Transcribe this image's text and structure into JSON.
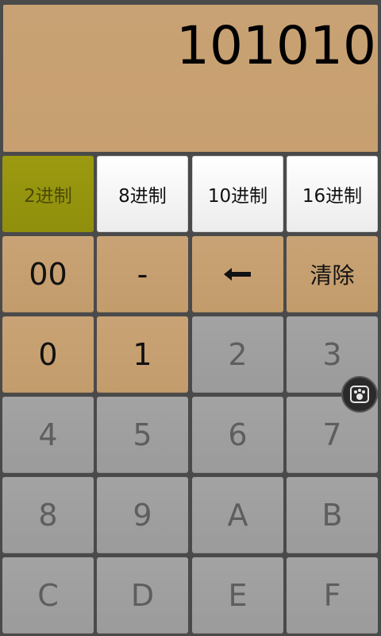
{
  "display": {
    "value": "101010"
  },
  "modes": [
    {
      "label": "2进制",
      "selected": true
    },
    {
      "label": "8进制",
      "selected": false
    },
    {
      "label": "10进制",
      "selected": false
    },
    {
      "label": "16进制",
      "selected": false
    }
  ],
  "controls": {
    "double_zero": "00",
    "minus": "-",
    "backspace": "←",
    "clear": "清除"
  },
  "digits": [
    "0",
    "1",
    "2",
    "3",
    "4",
    "5",
    "6",
    "7",
    "8",
    "9",
    "A",
    "B",
    "C",
    "D",
    "E",
    "F"
  ],
  "floating_button": {
    "icon": "paw-icon"
  },
  "colors": {
    "selected_mode": "#9b9a10",
    "enabled_key": "#c9a375",
    "disabled_key": "#a3a3a3",
    "background": "#4a4a4a"
  }
}
